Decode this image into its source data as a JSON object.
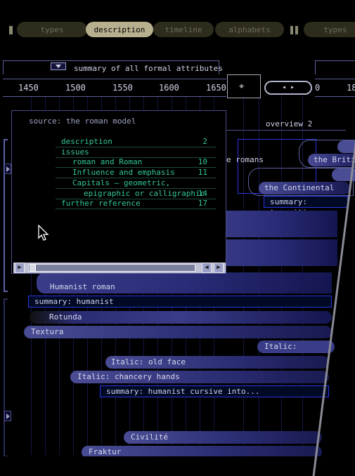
{
  "nav": {
    "tabs": [
      "types",
      "description",
      "timeline",
      "alphabets",
      "types"
    ],
    "active": "description"
  },
  "summary_header": "summary of all formal attributes",
  "timeline": {
    "years": [
      "1450",
      "1500",
      "1550",
      "1600",
      "1650"
    ],
    "right_years": [
      "0",
      "18"
    ]
  },
  "overview_label": "overview 2",
  "popup": {
    "source": "source: the roman model",
    "toc": [
      {
        "label": "description",
        "page": "2",
        "indent": 0
      },
      {
        "label": "issues",
        "page": "",
        "indent": 0
      },
      {
        "label": "roman and Roman",
        "page": "10",
        "indent": 1
      },
      {
        "label": "Influence and emphasis",
        "page": "11",
        "indent": 1
      },
      {
        "label": "Capitals — geometric,",
        "page": "",
        "indent": 1
      },
      {
        "label": "epigraphic or calligraphic",
        "page": "14",
        "indent": 2
      },
      {
        "label": "further reference",
        "page": "17",
        "indent": 0
      }
    ]
  },
  "right_items": {
    "romans": "e romans",
    "british": "the Briti",
    "continental": "the Continental tas",
    "summary_transit": "summary: transiti"
  },
  "bars": {
    "humanist_roman": "Humanist roman",
    "summary_humanist": "summary: humanist",
    "rotunda": "Rotunda",
    "textura": "Textura",
    "italic_secondary": "Italic: secondar",
    "italic_old_face": "Italic: old face",
    "italic_chancery": "Italic: chancery hands",
    "summary_cursive": "summary: humanist cursive into...",
    "civilite": "Civilité",
    "fraktur": "Fraktur"
  },
  "colors": {
    "accent_green": "#34c892",
    "bar_blue": "#2a2c72",
    "box_border": "#2a36e0",
    "nav_active": "#b7b08f"
  }
}
